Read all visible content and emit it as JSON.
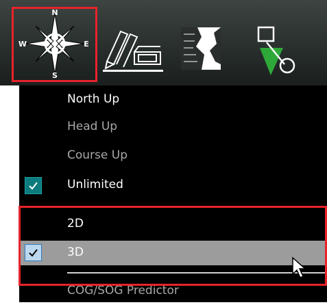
{
  "toolbar": {
    "buttons": [
      {
        "name": "compass-icon",
        "selected": true,
        "letters": {
          "n": "N",
          "w": "W",
          "e": "E",
          "s": "S"
        }
      },
      {
        "name": "pencil-layers-icon",
        "selected": false
      },
      {
        "name": "chart-map-icon",
        "selected": false
      },
      {
        "name": "route-icon",
        "selected": false
      }
    ]
  },
  "menu": {
    "items": [
      {
        "label": "North Up",
        "checked": false
      },
      {
        "label": "Head Up",
        "checked": false
      },
      {
        "label": "Course Up",
        "checked": false
      },
      {
        "label": "Unlimited",
        "checked": true
      },
      {
        "label": "2D",
        "checked": false
      },
      {
        "label": "3D",
        "checked": true,
        "highlighted": true
      },
      {
        "label": "COG/SOG Predictor",
        "checked": false
      }
    ]
  },
  "colors": {
    "highlight_box": "#e8232a",
    "checked_teal": "#0c7b7d",
    "hover_bg": "#9c9c9c"
  }
}
